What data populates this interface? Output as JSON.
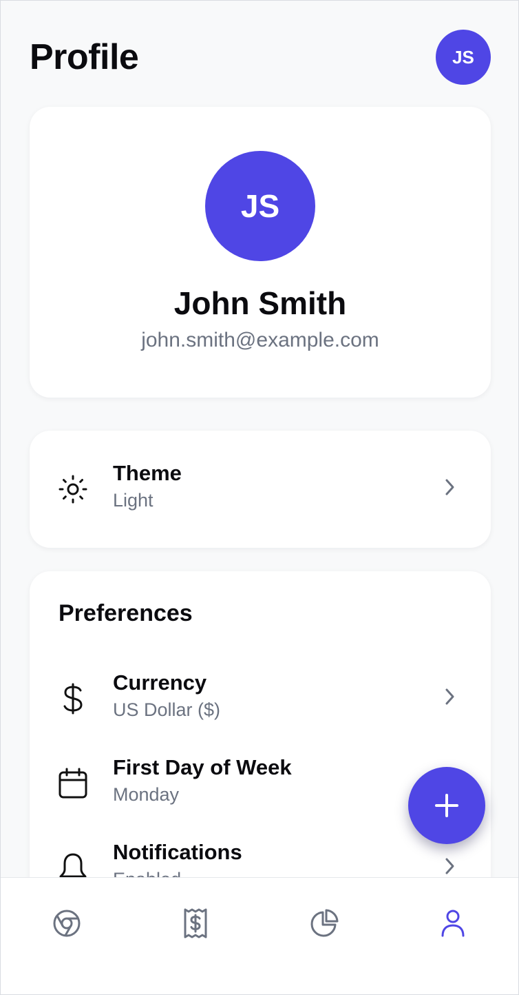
{
  "header": {
    "title": "Profile",
    "avatar_initials": "JS"
  },
  "profile": {
    "avatar_initials": "JS",
    "name": "John Smith",
    "email": "john.smith@example.com"
  },
  "theme": {
    "icon": "sun-icon",
    "label": "Theme",
    "value": "Light"
  },
  "preferences": {
    "heading": "Preferences",
    "items": [
      {
        "icon": "dollar-icon",
        "label": "Currency",
        "value": "US Dollar ($)"
      },
      {
        "icon": "calendar-icon",
        "label": "First Day of Week",
        "value": "Monday"
      },
      {
        "icon": "bell-icon",
        "label": "Notifications",
        "value": "Enabled"
      }
    ]
  },
  "fab": {
    "icon": "plus-icon"
  },
  "tabbar": {
    "tabs": [
      {
        "icon": "dashboard-icon",
        "active": false
      },
      {
        "icon": "receipt-icon",
        "active": false
      },
      {
        "icon": "pie-chart-icon",
        "active": false
      },
      {
        "icon": "user-icon",
        "active": true
      }
    ]
  },
  "colors": {
    "accent": "#4F46E5",
    "background": "#F8F9FA",
    "text_primary": "#0B0B0F",
    "text_secondary": "#6B7280",
    "icon_inactive": "#6B7280"
  }
}
